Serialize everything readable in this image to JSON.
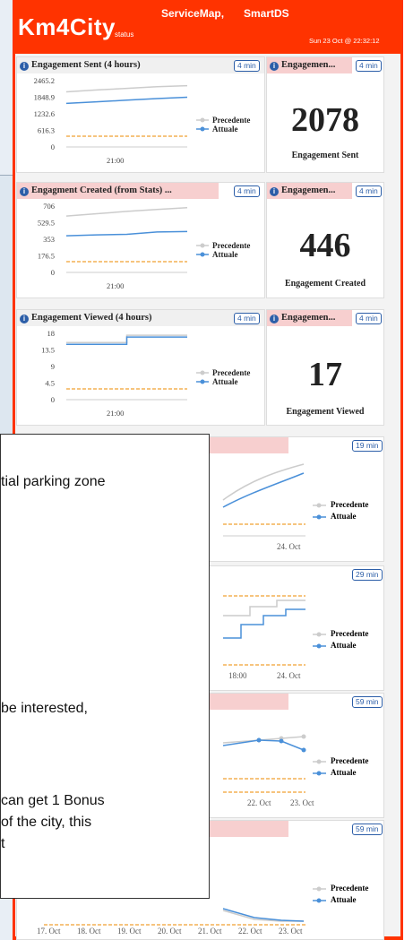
{
  "header": {
    "brand": "Km4City",
    "brand_sub": "status",
    "links": [
      "ServiceMap,",
      "SmartDS"
    ],
    "datetime": "Sun 23 Oct @ 22:32:12"
  },
  "colors": {
    "header_bg": "#ff3300",
    "current_line": "#4a90d9",
    "previous_line": "#cccccc",
    "threshold_line": "#f0a030"
  },
  "legend": {
    "previous": "Precedente",
    "current": "Attuale"
  },
  "widgets": [
    {
      "title": "Engagement Sent (4 hours)",
      "refresh": "4 min",
      "y_ticks": [
        "2465.2",
        "1848.9",
        "1232.6",
        "616.3",
        "0"
      ],
      "x_ticks": [
        "21:00"
      ],
      "value_title": "Engagemen...",
      "value_refresh": "4 min",
      "value": "2078",
      "value_label": "Engagement Sent"
    },
    {
      "title": "Engagment Created (from Stats) ...",
      "refresh": "4 min",
      "y_ticks": [
        "706",
        "529.5",
        "353",
        "176.5",
        "0"
      ],
      "x_ticks": [
        "21:00"
      ],
      "value_title": "Engagemen...",
      "value_refresh": "4 min",
      "value": "446",
      "value_label": "Engagement Created"
    },
    {
      "title": "Engagement Viewed (4 hours)",
      "refresh": "4 min",
      "y_ticks": [
        "18",
        "13.5",
        "9",
        "4.5",
        "0"
      ],
      "x_ticks": [
        "21:00"
      ],
      "value_title": "Engagemen...",
      "value_refresh": "4 min",
      "value": "17",
      "value_label": "Engagement Viewed"
    }
  ],
  "lower_widgets": [
    {
      "refresh": "19 min",
      "x_ticks": [
        "24. Oct"
      ]
    },
    {
      "refresh": "29 min",
      "x_ticks": [
        "18:00",
        "24. Oct"
      ]
    },
    {
      "refresh": "59 min",
      "x_ticks": [
        "22. Oct",
        "23. Oct"
      ]
    },
    {
      "refresh": "59 min",
      "x_ticks": [
        "17. Oct",
        "18. Oct",
        "19. Oct",
        "20. Oct",
        "21. Oct",
        "22. Oct",
        "23. Oct"
      ]
    }
  ],
  "overlay": {
    "lines": [
      "tial parking zone",
      "be interested,",
      "can get 1 Bonus",
      "of the city, this",
      "t"
    ]
  },
  "chart_data": [
    {
      "type": "line",
      "title": "Engagement Sent (4 hours)",
      "ylim": [
        0,
        2465.2
      ],
      "series": [
        {
          "name": "Precedente",
          "values": [
            2050,
            2120,
            2180,
            2240,
            2280
          ]
        },
        {
          "name": "Attuale",
          "values": [
            1620,
            1680,
            1740,
            1800,
            1850
          ]
        }
      ]
    },
    {
      "type": "line",
      "title": "Engagment Created (from Stats) ...",
      "ylim": [
        0,
        706
      ],
      "series": [
        {
          "name": "Precedente",
          "values": [
            600,
            625,
            650,
            670,
            690
          ]
        },
        {
          "name": "Attuale",
          "values": [
            390,
            400,
            405,
            430,
            435
          ]
        }
      ]
    },
    {
      "type": "line",
      "title": "Engagement Viewed (4 hours)",
      "ylim": [
        0,
        18
      ],
      "series": [
        {
          "name": "Precedente",
          "values": [
            15.5,
            15.5,
            17.5,
            17.5,
            17.5
          ]
        },
        {
          "name": "Attuale",
          "values": [
            15,
            15,
            17,
            17,
            17
          ]
        }
      ]
    }
  ]
}
